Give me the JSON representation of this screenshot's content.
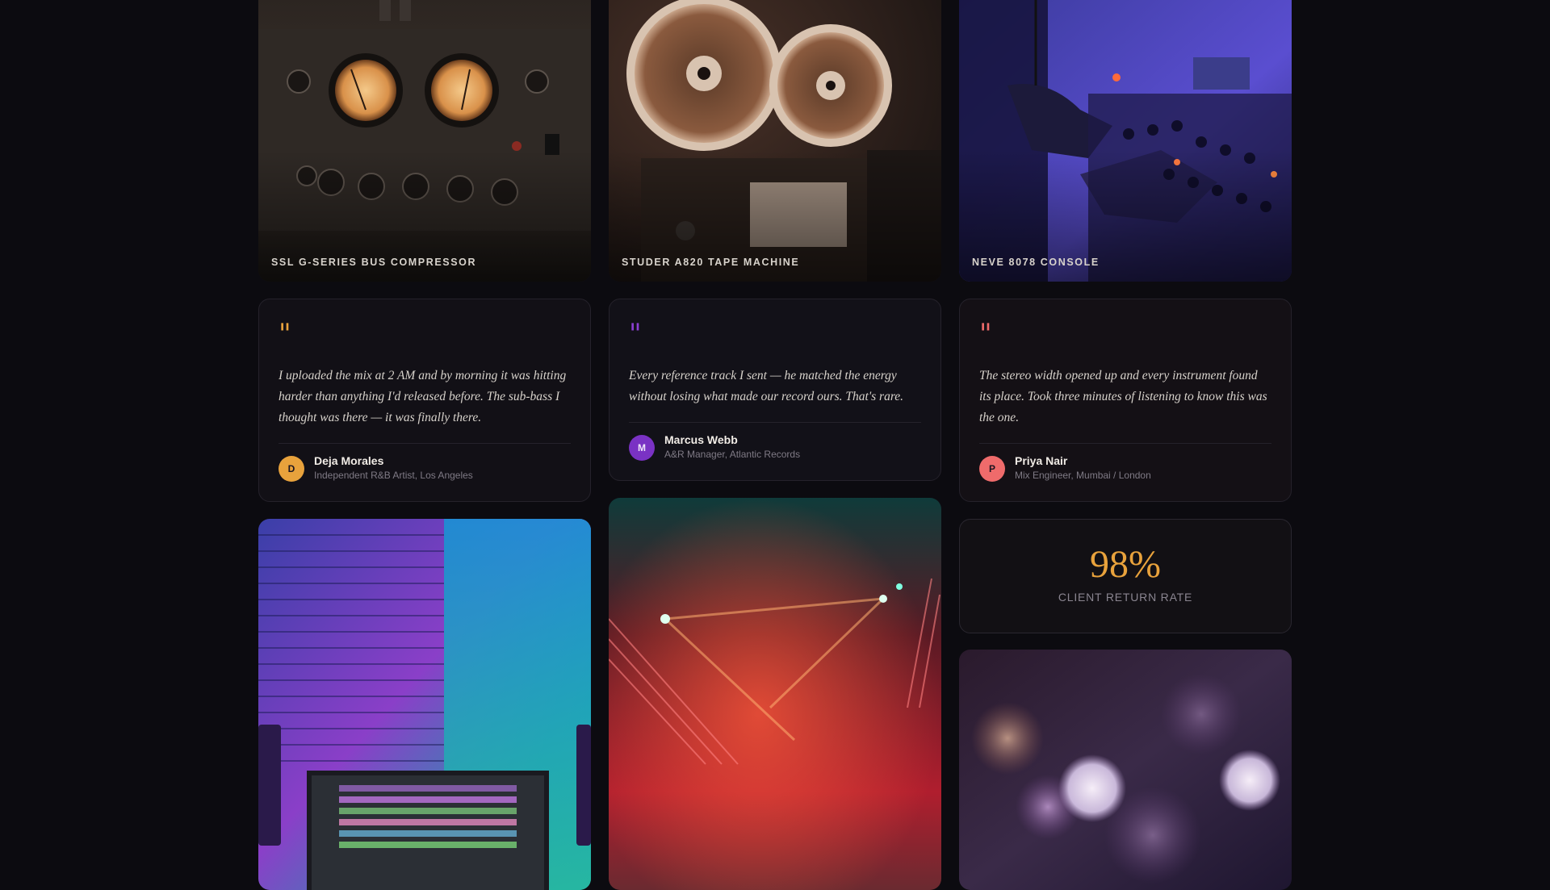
{
  "gallery": [
    {
      "caption": "SSL G-SERIES BUS COMPRESSOR"
    },
    {
      "caption": "STUDER A820 TAPE MACHINE"
    },
    {
      "caption": "NEVE 8078 CONSOLE"
    }
  ],
  "testimonials": [
    {
      "quote_mark": "\"",
      "text": "I uploaded the mix at 2 AM and by morning it was hitting harder than anything I'd released before. The sub-bass I thought was there — it was finally there.",
      "initial": "D",
      "name": "Deja Morales",
      "role": "Independent R&B Artist, Los Angeles",
      "accent": "#e8a23c"
    },
    {
      "quote_mark": "\"",
      "text": "Every reference track I sent — he matched the energy without losing what made our record ours. That's rare.",
      "initial": "M",
      "name": "Marcus Webb",
      "role": "A&R Manager, Atlantic Records",
      "accent": "#8b3fd1"
    },
    {
      "quote_mark": "\"",
      "text": "The stereo width opened up and every instrument found its place. Took three minutes of listening to know this was the one.",
      "initial": "P",
      "name": "Priya Nair",
      "role": "Mix Engineer, Mumbai / London",
      "accent": "#ef6b6b"
    }
  ],
  "stat": {
    "value": "98%",
    "label": "CLIENT RETURN RATE"
  }
}
